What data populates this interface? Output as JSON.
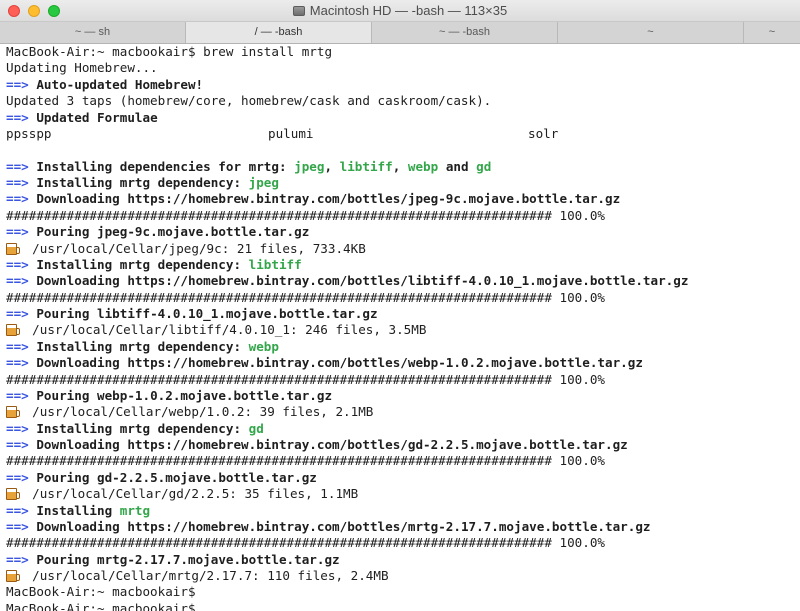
{
  "window": {
    "title": "Macintosh HD — -bash — 113×35",
    "disk_icon": "hard-disk-icon"
  },
  "tabs": [
    {
      "label": "~ — sh"
    },
    {
      "label": "/ — -bash"
    },
    {
      "label": "~ — -bash"
    },
    {
      "label": "~"
    },
    {
      "label": "~"
    }
  ],
  "terminal": {
    "prompt": "MacBook-Air:~ macbookair$",
    "command": " brew install mrtg",
    "arrow": "==>",
    "beer_icon": "beer-mug-icon",
    "l_updating": "Updating Homebrew...",
    "l_auto_updated": " Auto-updated Homebrew!",
    "l_updated_taps": "Updated 3 taps (homebrew/core, homebrew/cask and caskroom/cask).",
    "l_updated_formulae": " Updated Formulae",
    "formulae": [
      "ppsspp",
      "pulumi",
      "solr"
    ],
    "l_installing_deps": " Installing dependencies for mrtg: ",
    "deps": [
      "jpeg",
      "libtiff",
      "webp",
      "gd"
    ],
    "dep_sep_comma": ", ",
    "dep_sep_and": " and ",
    "l_installing_dep": " Installing mrtg dependency: ",
    "l_downloading": " Downloading ",
    "progress": "######################################################################## 100.0%",
    "l_pouring": " Pouring ",
    "jpeg_url": "https://homebrew.bintray.com/bottles/jpeg-9c.mojave.bottle.tar.gz",
    "jpeg_bottle": "jpeg-9c.mojave.bottle.tar.gz",
    "jpeg_cellar": "  /usr/local/Cellar/jpeg/9c: 21 files, 733.4KB",
    "libtiff_url": "https://homebrew.bintray.com/bottles/libtiff-4.0.10_1.mojave.bottle.tar.gz",
    "libtiff_bottle": "libtiff-4.0.10_1.mojave.bottle.tar.gz",
    "libtiff_cellar": "  /usr/local/Cellar/libtiff/4.0.10_1: 246 files, 3.5MB",
    "webp_url": "https://homebrew.bintray.com/bottles/webp-1.0.2.mojave.bottle.tar.gz",
    "webp_bottle": "webp-1.0.2.mojave.bottle.tar.gz",
    "webp_cellar": "  /usr/local/Cellar/webp/1.0.2: 39 files, 2.1MB",
    "gd_url": "https://homebrew.bintray.com/bottles/gd-2.2.5.mojave.bottle.tar.gz",
    "gd_bottle": "gd-2.2.5.mojave.bottle.tar.gz",
    "gd_cellar": "  /usr/local/Cellar/gd/2.2.5: 35 files, 1.1MB",
    "l_installing": " Installing ",
    "mrtg": "mrtg",
    "mrtg_url": "https://homebrew.bintray.com/bottles/mrtg-2.17.7.mojave.bottle.tar.gz",
    "mrtg_bottle": "mrtg-2.17.7.mojave.bottle.tar.gz",
    "mrtg_cellar": "  /usr/local/Cellar/mrtg/2.17.7: 110 files, 2.4MB"
  },
  "colors": {
    "arrow_blue": "#3a55e0",
    "dep_green": "#33a64a",
    "close_red": "#fe5f57",
    "minimize_yellow": "#febc2e",
    "zoom_green": "#28c840"
  }
}
